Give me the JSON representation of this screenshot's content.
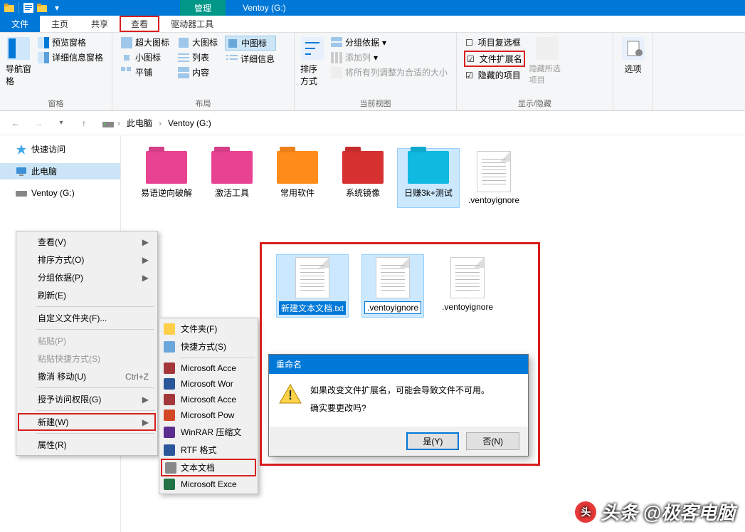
{
  "titlebar": {
    "context_tab": "管理",
    "window_title": "Ventoy (G:)"
  },
  "tabs": {
    "file": "文件",
    "home": "主页",
    "share": "共享",
    "view": "查看",
    "drive_tools": "驱动器工具"
  },
  "ribbon": {
    "panes": {
      "nav_pane": "导航窗格",
      "preview_pane": "预览窗格",
      "details_pane": "详细信息窗格",
      "group_label": "窗格"
    },
    "layout": {
      "extra_large": "超大图标",
      "large": "大图标",
      "medium": "中图标",
      "small": "小图标",
      "list": "列表",
      "details": "详细信息",
      "tiles": "平铺",
      "content": "内容",
      "group_label": "布局"
    },
    "current_view": {
      "sort_by": "排序方式",
      "group_by": "分组依据",
      "add_columns": "添加列",
      "size_all": "将所有列调整为合适的大小",
      "group_label": "当前视图"
    },
    "show_hide": {
      "item_checkboxes": "项目复选框",
      "file_ext": "文件扩展名",
      "hidden_items": "隐藏的项目",
      "hide_selected": "隐藏所选项目",
      "options": "选项",
      "group_label": "显示/隐藏"
    }
  },
  "breadcrumb": {
    "this_pc": "此电脑",
    "drive": "Ventoy (G:)"
  },
  "sidebar": {
    "quick_access": "快速访问",
    "this_pc": "此电脑",
    "ventoy": "Ventoy (G:)"
  },
  "files": [
    {
      "name": "易语逆向破解",
      "color": "#e84393"
    },
    {
      "name": "激活工具",
      "color": "#e84393"
    },
    {
      "name": "常用软件",
      "color": "#ff8c1a"
    },
    {
      "name": "系统镜像",
      "color": "#d63031"
    },
    {
      "name": "日赚3k+测试",
      "color": "#0fb9e0",
      "selected": true
    },
    {
      "name": ".ventoyignore",
      "type": "file"
    }
  ],
  "context_menu_primary": [
    {
      "label": "查看(V)",
      "arrow": true
    },
    {
      "label": "排序方式(O)",
      "arrow": true
    },
    {
      "label": "分组依据(P)",
      "arrow": true
    },
    {
      "label": "刷新(E)"
    },
    {
      "sep": true
    },
    {
      "label": "自定义文件夹(F)..."
    },
    {
      "sep": true
    },
    {
      "label": "粘贴(P)",
      "disabled": true
    },
    {
      "label": "粘贴快捷方式(S)",
      "disabled": true
    },
    {
      "label": "撤消 移动(U)",
      "shortcut": "Ctrl+Z"
    },
    {
      "sep": true
    },
    {
      "label": "授予访问权限(G)",
      "arrow": true
    },
    {
      "sep": true
    },
    {
      "label": "新建(W)",
      "arrow": true,
      "highlight": true
    },
    {
      "sep": true
    },
    {
      "label": "属性(R)"
    }
  ],
  "context_menu_secondary": [
    {
      "label": "文件夹(F)",
      "icon": "folder"
    },
    {
      "label": "快捷方式(S)",
      "icon": "shortcut"
    },
    {
      "sep": true
    },
    {
      "label": "Microsoft Acce",
      "icon": "access"
    },
    {
      "label": "Microsoft Wor",
      "icon": "word"
    },
    {
      "label": "Microsoft Acce",
      "icon": "access"
    },
    {
      "label": "Microsoft Pow",
      "icon": "ppt"
    },
    {
      "label": "WinRAR 压缩文",
      "icon": "rar"
    },
    {
      "label": "RTF 格式",
      "icon": "rtf"
    },
    {
      "label": "文本文档",
      "icon": "txt",
      "highlight": true
    },
    {
      "label": "Microsoft Exce",
      "icon": "excel"
    }
  ],
  "overlay_files": [
    {
      "label": "新建文本文档.txt",
      "editing": true,
      "sel": true
    },
    {
      "label": ".ventoyignore",
      "editbox": true,
      "sel": true
    },
    {
      "label": ".ventoyignore"
    }
  ],
  "dialog": {
    "title": "重命名",
    "line1": "如果改变文件扩展名，可能会导致文件不可用。",
    "line2": "确实要更改吗?",
    "yes": "是(Y)",
    "no": "否(N)"
  },
  "watermark": "头条 @极客电脑"
}
